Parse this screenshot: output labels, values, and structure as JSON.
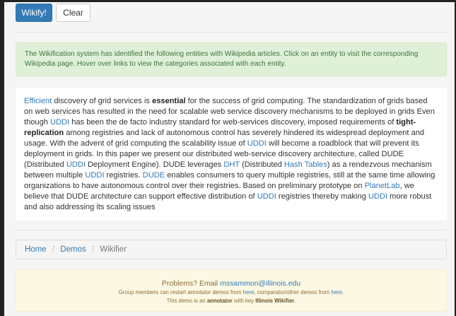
{
  "toolbar": {
    "wikify_label": "Wikify!",
    "clear_label": "Clear"
  },
  "alert": {
    "text": "The Wikification system has identified the following entities with Wikipedia articles. Click on an entity to visit the corresponding Wikipedia page. Hover over links to view the categories associated with each entity."
  },
  "article": {
    "segments": [
      {
        "type": "link",
        "text": "Efficient"
      },
      {
        "type": "text",
        "text": " discovery of grid services is "
      },
      {
        "type": "bold",
        "text": "essential"
      },
      {
        "type": "text",
        "text": " for the success of grid computing. The standardization of grids based on web services has resulted in the need for scalable web service discovery mechanisms to be deployed in grids Even though "
      },
      {
        "type": "link",
        "text": "UDDI"
      },
      {
        "type": "text",
        "text": " has been the de facto industry standard for web-services discovery, imposed requirements of "
      },
      {
        "type": "bold",
        "text": "tight-replication"
      },
      {
        "type": "text",
        "text": " among registries and lack of autonomous control has severely hindered its widespread deployment and usage. With the advent of grid computing the scalability issue of "
      },
      {
        "type": "link",
        "text": "UDDI"
      },
      {
        "type": "text",
        "text": " will become a roadblock that will prevent its deployment in grids. In this paper we present our distributed web-service discovery architecture, called DUDE (Distributed "
      },
      {
        "type": "link",
        "text": "UDDI"
      },
      {
        "type": "text",
        "text": " Deployment Engine). DUDE leverages "
      },
      {
        "type": "link",
        "text": "DHT"
      },
      {
        "type": "text",
        "text": " (Distributed "
      },
      {
        "type": "link",
        "text": "Hash Tables"
      },
      {
        "type": "text",
        "text": ") as a rendezvous mechanism between multiple "
      },
      {
        "type": "link",
        "text": "UDDI"
      },
      {
        "type": "text",
        "text": " registries. "
      },
      {
        "type": "link",
        "text": "DUDE"
      },
      {
        "type": "text",
        "text": " enables consumers to query multiple registries, still at the same time allowing organizations to have autonomous control over their registries. Based on preliminary prototype on "
      },
      {
        "type": "link",
        "text": "PlanetLab"
      },
      {
        "type": "text",
        "text": ", we believe that DUDE architecture can support effective distribution of "
      },
      {
        "type": "link",
        "text": "UDDI"
      },
      {
        "type": "text",
        "text": " registries thereby making "
      },
      {
        "type": "link",
        "text": "UDDI"
      },
      {
        "type": "text",
        "text": " more robust and also addressing its scaling issues"
      }
    ]
  },
  "breadcrumb": {
    "home": "Home",
    "separator": "/",
    "demos": "Demos",
    "current": "Wikifier"
  },
  "footer": {
    "problems_prefix": "Problems? Email ",
    "email": "mssammon@illinois.edu",
    "restart_prefix": "Group members can restart annotator demos from ",
    "restart_link": "here",
    "restart_middle": ", comparator/other demos from ",
    "other_link": "here",
    "restart_suffix": ".",
    "annotator_prefix": "This demo is an ",
    "annotator_word": "annotator",
    "annotator_middle": " with key ",
    "annotator_key": "Illinois Wikifier",
    "annotator_suffix": "."
  }
}
